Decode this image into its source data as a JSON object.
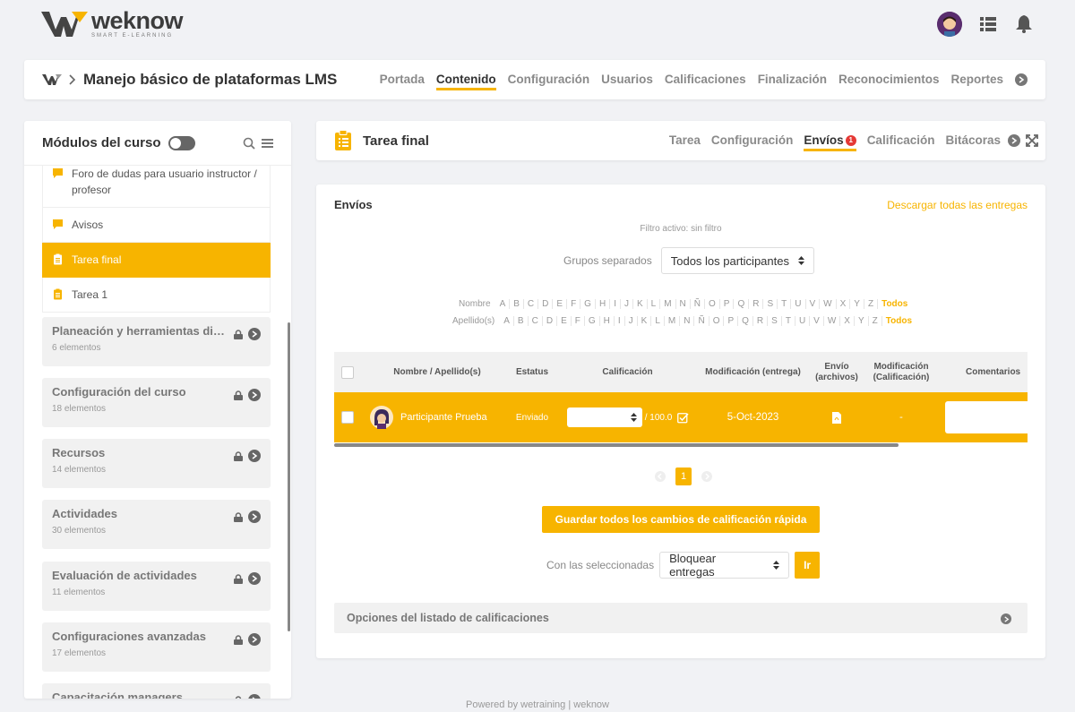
{
  "brand": {
    "name": "weknow",
    "tagline": "SMART E-LEARNING"
  },
  "course": {
    "title": "Manejo básico de plataformas LMS",
    "tabs": [
      "Portada",
      "Contenido",
      "Configuración",
      "Usuarios",
      "Calificaciones",
      "Finalización",
      "Reconocimientos",
      "Reportes"
    ],
    "active_tab": "Contenido"
  },
  "sidebar": {
    "title": "Módulos del curso",
    "items": [
      {
        "label": "Foro de dudas para usuario instructor / profesor",
        "icon": "chat-icon"
      },
      {
        "label": "Avisos",
        "icon": "chat-icon"
      },
      {
        "label": "Tarea final",
        "icon": "clipboard-icon",
        "active": true
      },
      {
        "label": "Tarea 1",
        "icon": "clipboard-icon"
      }
    ],
    "modules": [
      {
        "title": "Planeación y herramientas disp...",
        "count": "6 elementos"
      },
      {
        "title": "Configuración del curso",
        "count": "18 elementos"
      },
      {
        "title": "Recursos",
        "count": "14 elementos"
      },
      {
        "title": "Actividades",
        "count": "30 elementos"
      },
      {
        "title": "Evaluación de actividades",
        "count": "11 elementos"
      },
      {
        "title": "Configuraciones avanzadas",
        "count": "17 elementos"
      },
      {
        "title": "Capacitación managers",
        "count": ""
      }
    ]
  },
  "activity": {
    "title": "Tarea final",
    "tabs": [
      "Tarea",
      "Configuración",
      "Envíos",
      "Calificación",
      "Bitácoras"
    ],
    "active_tab": "Envíos",
    "envios_badge": "1"
  },
  "panel": {
    "title": "Envíos",
    "download_link": "Descargar todas las entregas",
    "filter_text": "Filtro activo: sin filtro",
    "groups_label": "Grupos separados",
    "groups_value": "Todos los participantes",
    "first_name_label": "Nombre",
    "last_name_label": "Apellido(s)",
    "letters": [
      "A",
      "B",
      "C",
      "D",
      "E",
      "F",
      "G",
      "H",
      "I",
      "J",
      "K",
      "L",
      "M",
      "N",
      "Ñ",
      "O",
      "P",
      "Q",
      "R",
      "S",
      "T",
      "U",
      "V",
      "W",
      "X",
      "Y",
      "Z"
    ],
    "all_label": "Todos",
    "table": {
      "headers": [
        "Nombre / Apellido(s)",
        "Estatus",
        "Calificación",
        "Modificación (entrega)",
        "Envío (archivos)",
        "Modificación (Calificación)",
        "Comentarios"
      ],
      "row": {
        "name": "Participante Prueba",
        "status": "Enviado",
        "grade_max": "/ 100.0",
        "modified": "5-Oct-2023",
        "grade_modified": "-"
      }
    },
    "page": "1",
    "save_button": "Guardar todos los cambios de calificación rápida",
    "with_selected_label": "Con las seleccionadas",
    "with_selected_value": "Bloquear entregas",
    "go_button": "Ir",
    "options_title": "Opciones del listado de calificaciones"
  },
  "footer": "Powered by wetraining | weknow",
  "colors": {
    "accent": "#f7b400",
    "badge": "#e53935"
  }
}
